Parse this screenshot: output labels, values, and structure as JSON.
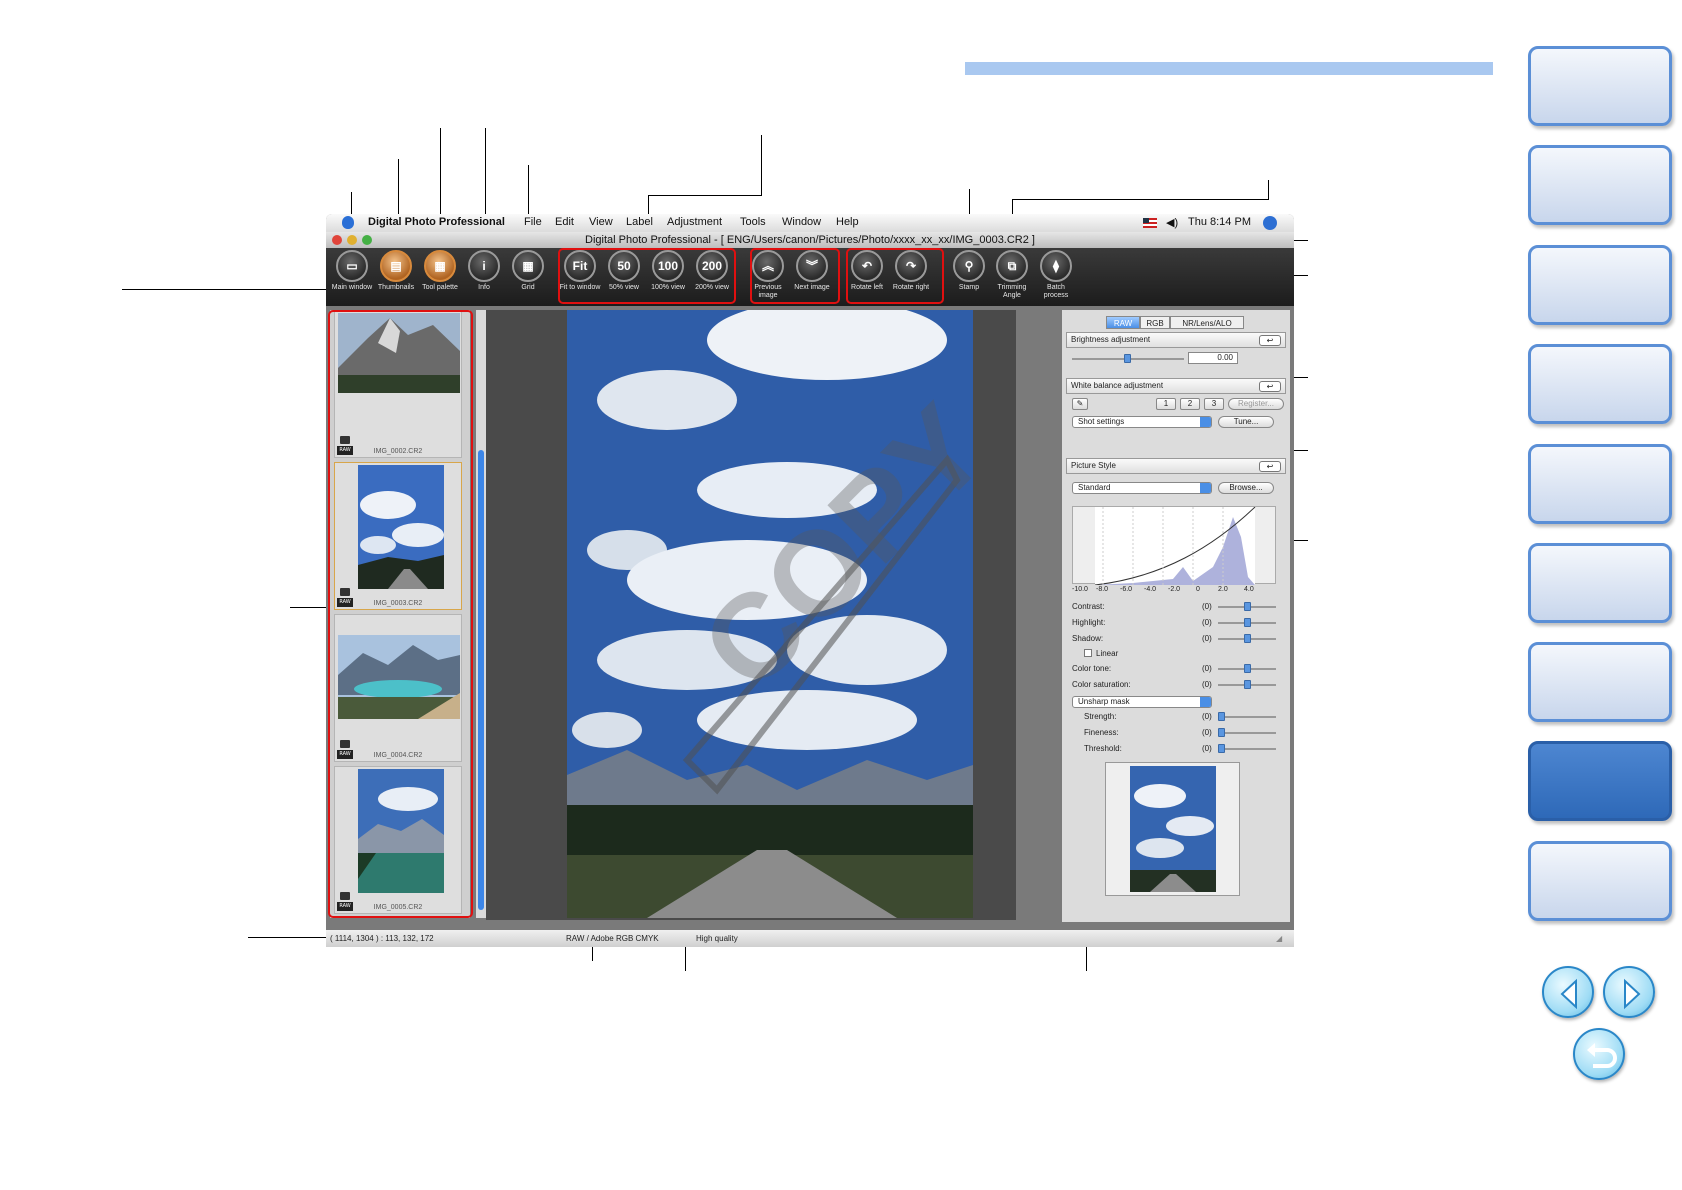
{
  "menubar": {
    "app_name": "Digital Photo Professional",
    "items": [
      "File",
      "Edit",
      "View",
      "Label",
      "Adjustment",
      "Tools",
      "Window",
      "Help"
    ],
    "clock": "Thu 8:14 PM"
  },
  "window": {
    "title": "Digital Photo Professional - [ ENG/Users/canon/Pictures/Photo/xxxx_xx_xx/IMG_0003.CR2 ]"
  },
  "toolbar": {
    "main_window": "Main window",
    "thumbnails": "Thumbnails",
    "tool_palette": "Tool palette",
    "info": "Info",
    "grid": "Grid",
    "fit_to_window": "Fit to window",
    "fit_glyph": "Fit",
    "view_50": "50% view",
    "glyph_50": "50",
    "view_100": "100% view",
    "glyph_100": "100",
    "view_200": "200% view",
    "glyph_200": "200",
    "previous_image": "Previous image",
    "next_image": "Next image",
    "rotate_left": "Rotate left",
    "rotate_right": "Rotate right",
    "stamp": "Stamp",
    "trimming_angle": "Trimming Angle",
    "batch_process": "Batch process"
  },
  "thumbnails": [
    {
      "name": "IMG_0002.CR2",
      "badge": "RAW"
    },
    {
      "name": "IMG_0003.CR2",
      "badge": "RAW"
    },
    {
      "name": "IMG_0004.CR2",
      "badge": "RAW"
    },
    {
      "name": "IMG_0005.CR2",
      "badge": "RAW"
    }
  ],
  "palette": {
    "tabs": [
      "RAW",
      "RGB",
      "NR/Lens/ALO"
    ],
    "brightness": {
      "title": "Brightness adjustment",
      "value": "0.00"
    },
    "white_balance": {
      "title": "White balance adjustment",
      "slots": [
        "1",
        "2",
        "3"
      ],
      "register": "Register...",
      "preset": "Shot settings",
      "tune": "Tune..."
    },
    "picture_style": {
      "title": "Picture Style",
      "preset": "Standard",
      "browse": "Browse...",
      "axis_ticks": [
        "-10.0",
        "-8.0",
        "-6.0",
        "-4.0",
        "-2.0",
        "0",
        "2.0",
        "4.0"
      ],
      "contrast": "Contrast:",
      "highlight": "Highlight:",
      "shadow": "Shadow:",
      "linear": "Linear",
      "color_tone": "Color tone:",
      "color_saturation": "Color saturation:",
      "sharpness_mode": "Unsharp mask",
      "strength": "Strength:",
      "fineness": "Fineness:",
      "threshold": "Threshold:",
      "value_text": "(0)"
    }
  },
  "status": {
    "coords": "( 1114, 1304 ) : 113, 132, 172",
    "color_space": "RAW / Adobe RGB  CMYK",
    "quality": "High quality"
  },
  "colors": {
    "highlight_box": "#e01010",
    "nav_tab_active": "#2e69b8",
    "accent_band": "#a9c8f0"
  },
  "nav": {
    "previous_icon": "arrow-left-icon",
    "next_icon": "arrow-right-icon",
    "return_icon": "return-icon"
  }
}
